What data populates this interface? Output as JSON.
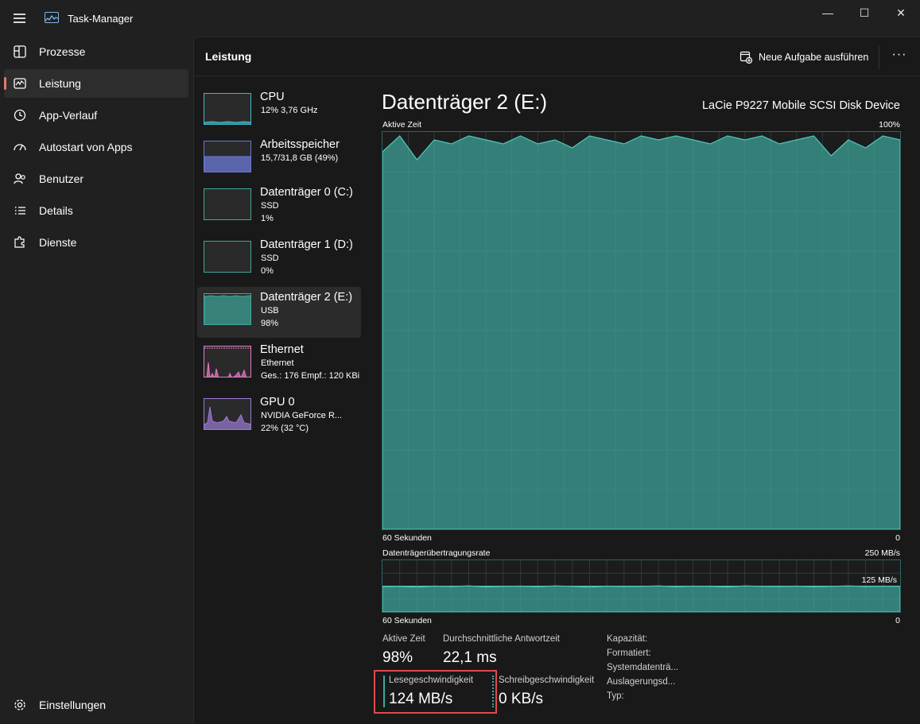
{
  "app": {
    "title": "Task-Manager",
    "hamburger_icon": "hamburger-menu-icon",
    "window_controls": {
      "minimize": "—",
      "maximize": "☐",
      "close": "✕"
    }
  },
  "sidebar": {
    "items": [
      {
        "label": "Prozesse",
        "icon": "processes-grid-icon",
        "active": false
      },
      {
        "label": "Leistung",
        "icon": "performance-chart-icon",
        "active": true
      },
      {
        "label": "App-Verlauf",
        "icon": "history-clock-icon",
        "active": false
      },
      {
        "label": "Autostart von Apps",
        "icon": "startup-gauge-icon",
        "active": false
      },
      {
        "label": "Benutzer",
        "icon": "users-icon",
        "active": false
      },
      {
        "label": "Details",
        "icon": "details-list-icon",
        "active": false
      },
      {
        "label": "Dienste",
        "icon": "services-puzzle-icon",
        "active": false
      }
    ],
    "settings_label": "Einstellungen"
  },
  "header": {
    "title": "Leistung",
    "new_task_label": "Neue Aufgabe ausführen",
    "more_label": "···"
  },
  "devices": [
    {
      "name": "CPU",
      "line1": "12% 3,76 GHz",
      "line2": "",
      "line3": "",
      "color": "#3fb8c8",
      "active": false
    },
    {
      "name": "Arbeitsspeicher",
      "line1": "15,7/31,8 GB (49%)",
      "line2": "",
      "line3": "",
      "color": "#6a78d4",
      "active": false
    },
    {
      "name": "Datenträger 0 (C:)",
      "line1": "SSD",
      "line2": "1%",
      "line3": "",
      "color": "#3fa89c",
      "active": false
    },
    {
      "name": "Datenträger 1 (D:)",
      "line1": "SSD",
      "line2": "0%",
      "line3": "",
      "color": "#3fa89c",
      "active": false
    },
    {
      "name": "Datenträger 2 (E:)",
      "line1": "USB",
      "line2": "98%",
      "line3": "",
      "color": "#3fa89c",
      "active": true
    },
    {
      "name": "Ethernet",
      "line1": "Ethernet",
      "line2": "Ges.: 176 Empf.: 120 KBi",
      "line3": "",
      "color": "#e27bc3",
      "active": false
    },
    {
      "name": "GPU 0",
      "line1": "NVIDIA GeForce R...",
      "line2": "22% (32 °C)",
      "line3": "",
      "color": "#9b7bd4",
      "active": false
    }
  ],
  "detail": {
    "title": "Datenträger 2 (E:)",
    "device_name": "LaCie P9227 Mobile SCSI Disk Device",
    "active_chart": {
      "label": "Aktive Zeit",
      "max_label": "100%",
      "time_label": "60 Sekunden",
      "min_label": "0"
    },
    "transfer_chart": {
      "label": "Datenträgerübertragungsrate",
      "max_label": "250 MB/s",
      "mid_label": "125 MB/s",
      "time_label": "60 Sekunden",
      "min_label": "0"
    },
    "stats": {
      "active_time_label": "Aktive Zeit",
      "active_time_value": "98%",
      "response_label": "Durchschnittliche Antwortzeit",
      "response_value": "22,1 ms",
      "read_label": "Lesegeschwindigkeit",
      "read_value": "124 MB/s",
      "write_label": "Schreibgeschwindigkeit",
      "write_value": "0 KB/s"
    },
    "info": {
      "capacity": "Kapazität:",
      "formatted": "Formatiert:",
      "system_disk": "Systemdatenträ...",
      "paging": "Auslagerungsd...",
      "type": "Typ:"
    },
    "accent_color": "#3fa89c"
  },
  "chart_data": [
    {
      "type": "area",
      "title": "Aktive Zeit",
      "xlabel": "60 Sekunden",
      "ylabel": "",
      "ylim": [
        0,
        100
      ],
      "x": [
        60,
        58,
        56,
        54,
        52,
        50,
        48,
        46,
        44,
        42,
        40,
        38,
        36,
        34,
        32,
        30,
        28,
        26,
        24,
        22,
        20,
        18,
        16,
        14,
        12,
        10,
        8,
        6,
        4,
        2,
        0
      ],
      "values": [
        95,
        99,
        93,
        98,
        97,
        99,
        98,
        97,
        99,
        97,
        98,
        96,
        99,
        98,
        97,
        99,
        98,
        99,
        98,
        97,
        99,
        98,
        99,
        97,
        98,
        99,
        94,
        98,
        96,
        99,
        98
      ]
    },
    {
      "type": "area",
      "title": "Datenträgerübertragungsrate",
      "xlabel": "60 Sekunden",
      "ylim": [
        0,
        250
      ],
      "x": [
        60,
        58,
        56,
        54,
        52,
        50,
        48,
        46,
        44,
        42,
        40,
        38,
        36,
        34,
        32,
        30,
        28,
        26,
        24,
        22,
        20,
        18,
        16,
        14,
        12,
        10,
        8,
        6,
        4,
        2,
        0
      ],
      "values": [
        122,
        124,
        120,
        125,
        123,
        126,
        121,
        124,
        125,
        122,
        126,
        124,
        120,
        125,
        123,
        124,
        126,
        122,
        125,
        124,
        121,
        126,
        124,
        123,
        125,
        122,
        124,
        126,
        123,
        125,
        124
      ]
    }
  ]
}
